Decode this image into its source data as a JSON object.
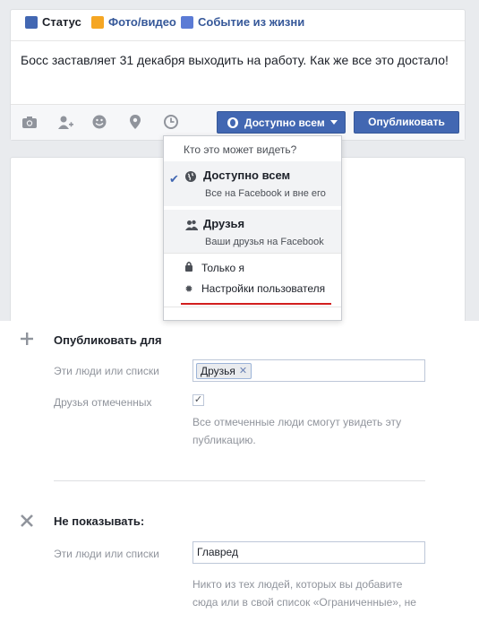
{
  "composer": {
    "tabs": [
      {
        "label": "Статус",
        "icon": "status-pencil-icon"
      },
      {
        "label": "Фото/видео",
        "icon": "photo-video-icon"
      },
      {
        "label": "Событие из жизни",
        "icon": "life-event-flag-icon"
      }
    ],
    "text": "Босс заставляет 31 декабря выходить на работу. Как же все это достало!",
    "audience_button": "Доступно всем",
    "publish_button": "Опубликовать",
    "footer_icons": [
      "camera-icon",
      "tag-friends-icon",
      "smiley-icon",
      "location-pin-icon",
      "clock-icon"
    ]
  },
  "audience_menu": {
    "header": "Кто это может видеть?",
    "options": [
      {
        "title": "Доступно всем",
        "subtitle": "Все на Facebook и вне его",
        "selected": true
      },
      {
        "title": "Друзья",
        "subtitle": "Ваши друзья на Facebook",
        "selected": false
      }
    ],
    "only_me": "Только я",
    "custom": "Настройки пользователя"
  },
  "share_with": {
    "title": "Опубликовать для",
    "people_label": "Эти люди или списки",
    "token": "Друзья",
    "tagged_label": "Друзья отмеченных",
    "tagged_checked": true,
    "help_line1": "Все отмеченные люди смогут увидеть эту",
    "help_line2": "публикацию."
  },
  "dont_share": {
    "title": "Не показывать:",
    "people_label": "Эти люди или списки",
    "value": "Главред",
    "help_line1": "Никто из тех людей, которых вы добавите",
    "help_line2": "сюда или в свой список «Ограниченные», не"
  },
  "colors": {
    "fb_blue": "#4267b2",
    "highlight_underline": "#d21e1e",
    "background": "#e9ebee"
  }
}
